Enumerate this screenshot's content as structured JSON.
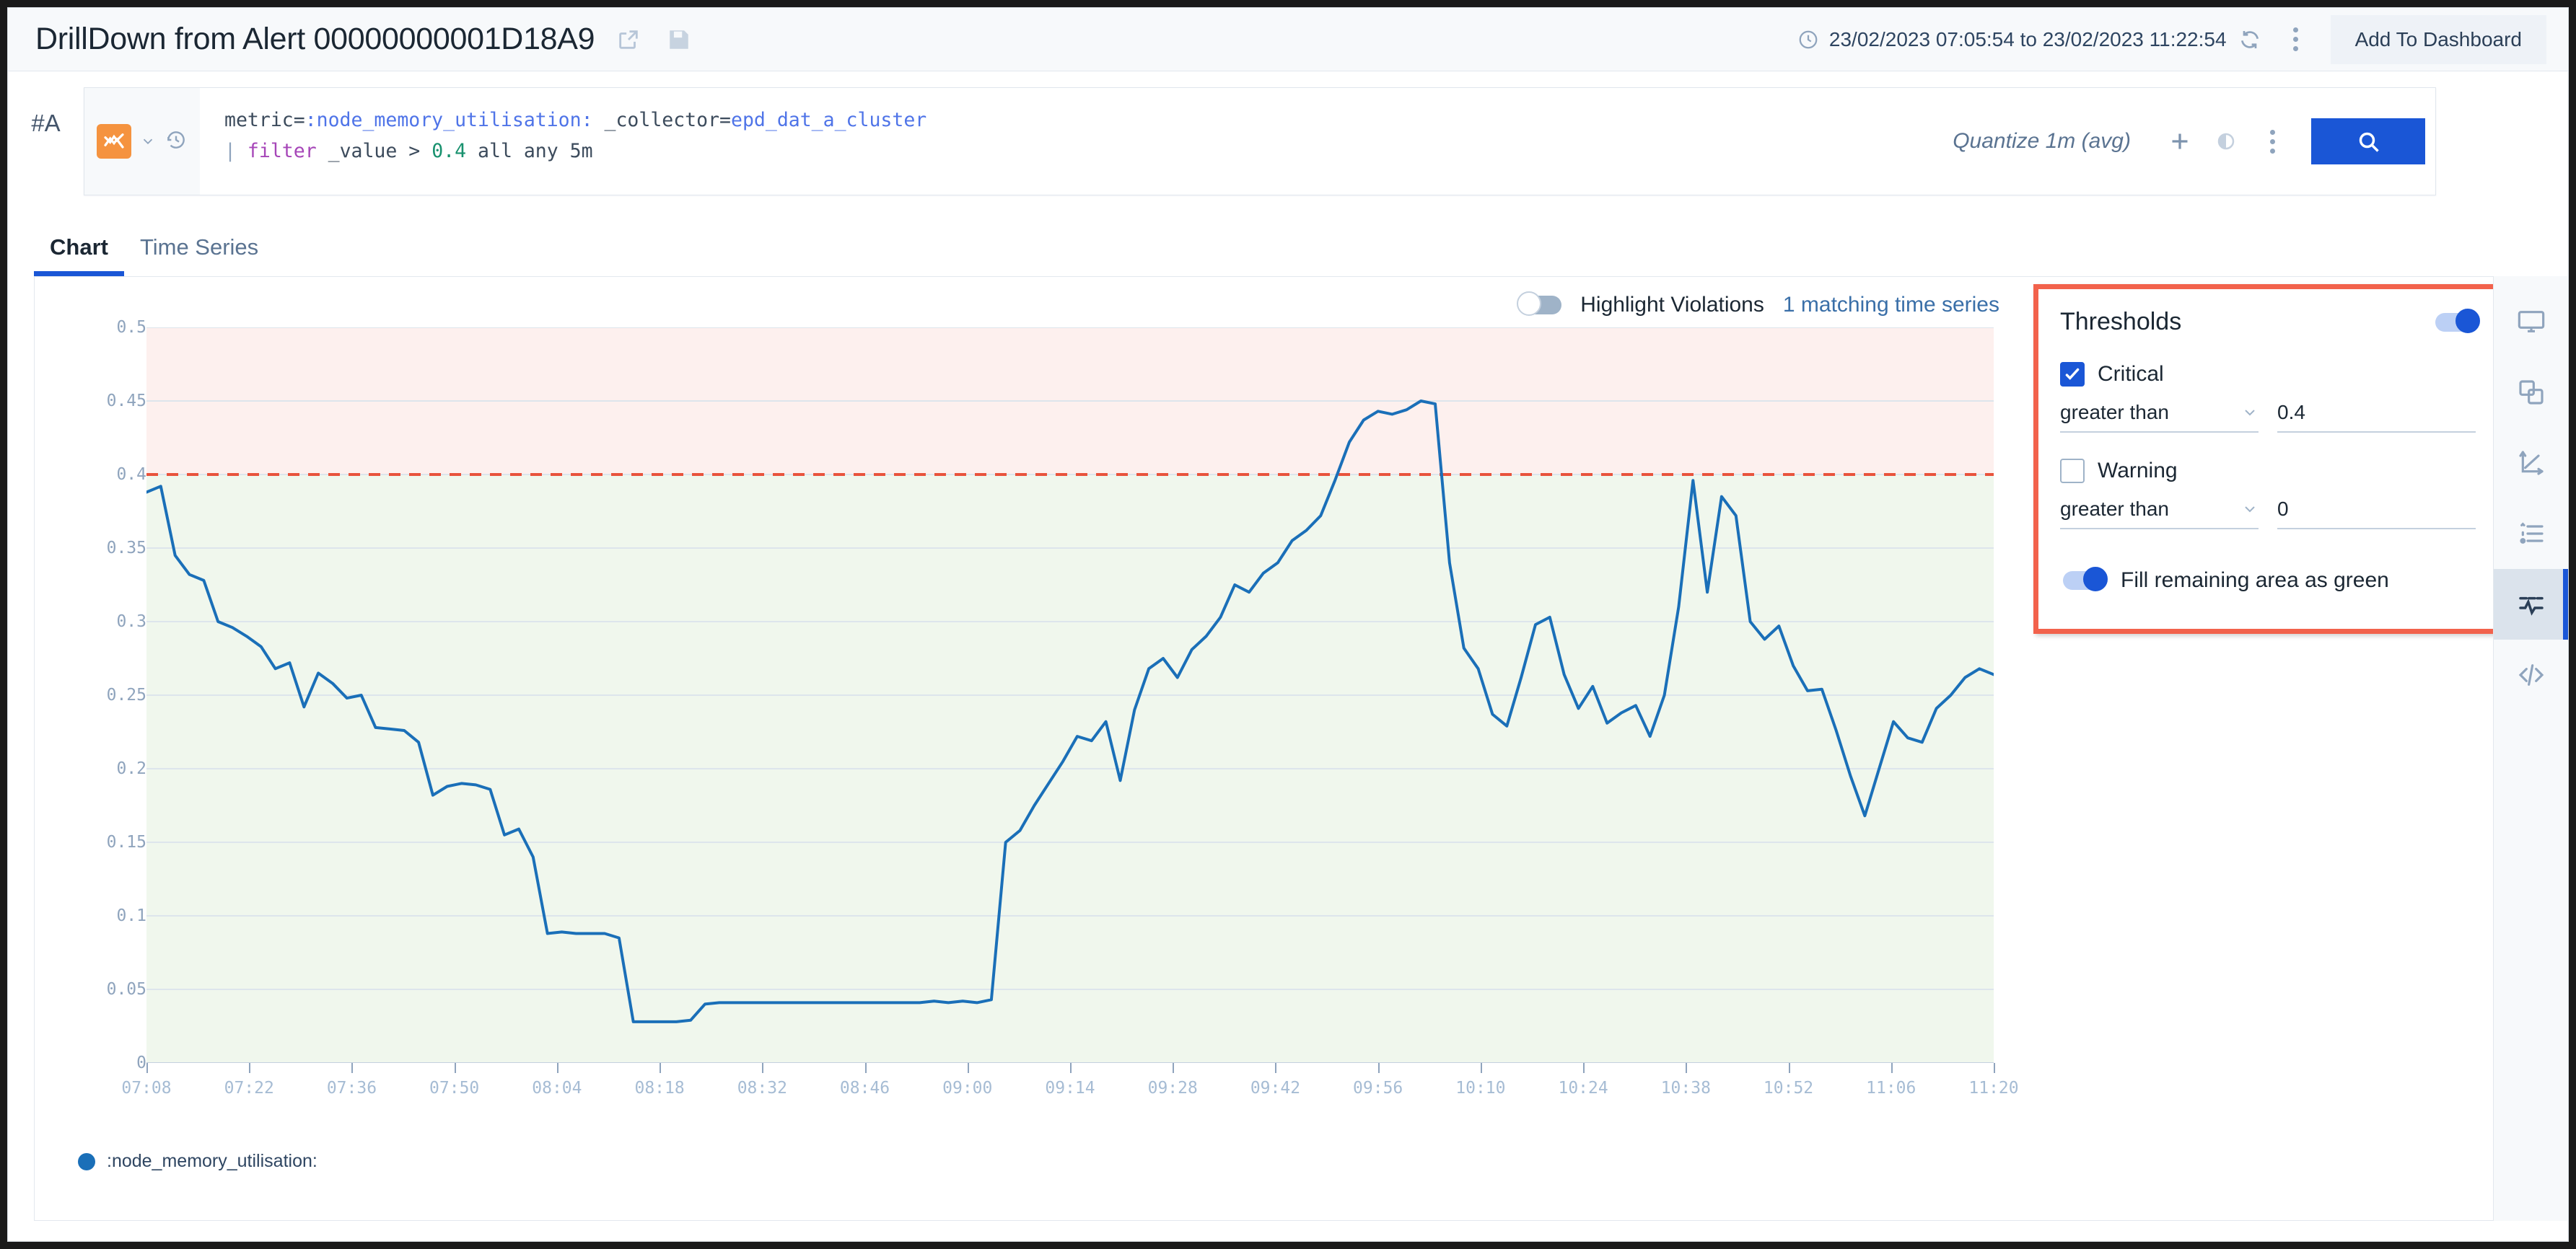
{
  "titlebar": {
    "title": "DrillDown from Alert 00000000001D18A9",
    "share_icon": "share-export-icon",
    "save_icon": "floppy-save-icon",
    "clock_icon": "clock-icon",
    "time_range": "23/02/2023 07:05:54 to 23/02/2023 11:22:54",
    "refresh_icon": "refresh-icon",
    "menu_icon": "kebab-menu-icon",
    "add_to_dashboard": "Add To Dashboard"
  },
  "query": {
    "id_label": "#A",
    "type_icon": "chart-type-icon",
    "chevron_icon": "chevron-down-icon",
    "history_icon": "history-clock-icon",
    "line1_prefix": "metric=",
    "line1_metric": ":node_memory_utilisation:",
    "line1_mid": " _collector=",
    "line1_collector": "epd_dat_a_cluster",
    "line2_pipe": "| ",
    "line2_kw": "filter",
    "line2_mid": " _value > ",
    "line2_num": "0.4",
    "line2_tail": " all any 5m",
    "quantize": "Quantize 1m (avg)",
    "add_icon": "plus-icon",
    "eye_icon": "eye-visibility-icon",
    "more_icon": "kebab-menu-icon",
    "search_icon": "search-icon"
  },
  "tabs": [
    {
      "label": "Chart",
      "active": true
    },
    {
      "label": "Time Series",
      "active": false
    }
  ],
  "chart_header": {
    "highlight_violations_label": "Highlight Violations",
    "highlight_violations_on": false,
    "matching_series": "1 matching time series"
  },
  "thresholds": {
    "title": "Thresholds",
    "enabled": true,
    "critical": {
      "label": "Critical",
      "checked": true,
      "operator": "greater than",
      "value": "0.4"
    },
    "warning": {
      "label": "Warning",
      "checked": false,
      "operator": "greater than",
      "value": "0"
    },
    "fill_label": "Fill remaining area as green",
    "fill_on": true,
    "accent_border": "#f2624c"
  },
  "rail": [
    {
      "icon": "monitor-display-icon",
      "active": false
    },
    {
      "icon": "layers-icon",
      "active": false
    },
    {
      "icon": "axes-icon",
      "active": false
    },
    {
      "icon": "list-icon",
      "active": false
    },
    {
      "icon": "thresholds-icon",
      "active": true
    },
    {
      "icon": "code-icon",
      "active": false
    }
  ],
  "legend": {
    "series_label": ":node_memory_utilisation:",
    "color": "#1a6fb8"
  },
  "chart_data": {
    "type": "line",
    "title": "",
    "xlabel": "",
    "ylabel": "metric=:node_memory_utilisation:",
    "ylim": [
      0,
      0.5
    ],
    "yticks": [
      0,
      0.05,
      0.1,
      0.15,
      0.2,
      0.25,
      0.3,
      0.35,
      0.4,
      0.45,
      0.5
    ],
    "xticks": [
      "07:08",
      "07:22",
      "07:36",
      "07:50",
      "08:04",
      "08:18",
      "08:32",
      "08:46",
      "09:00",
      "09:14",
      "09:28",
      "09:42",
      "09:56",
      "10:10",
      "10:24",
      "10:38",
      "10:52",
      "11:06",
      "11:20"
    ],
    "x_start": "07:05:54",
    "x_end": "11:22:54",
    "grid": true,
    "legend_position": "bottom-left",
    "line_color": "#1a6fb8",
    "bands": [
      {
        "name": "critical",
        "from": 0.4,
        "to": 0.5,
        "color": "#fdf0ee"
      },
      {
        "name": "ok",
        "from": 0,
        "to": 0.4,
        "color": "#f0f7ed"
      }
    ],
    "threshold_line": {
      "value": 0.4,
      "color": "#e8533c",
      "style": "dashed"
    },
    "series": [
      {
        "name": ":node_memory_utilisation:",
        "values": [
          0.388,
          0.392,
          0.345,
          0.332,
          0.328,
          0.3,
          0.296,
          0.29,
          0.283,
          0.268,
          0.272,
          0.242,
          0.265,
          0.258,
          0.248,
          0.25,
          0.228,
          0.227,
          0.226,
          0.218,
          0.182,
          0.188,
          0.19,
          0.189,
          0.186,
          0.155,
          0.159,
          0.14,
          0.088,
          0.089,
          0.088,
          0.088,
          0.088,
          0.085,
          0.028,
          0.028,
          0.028,
          0.028,
          0.029,
          0.04,
          0.041,
          0.041,
          0.041,
          0.041,
          0.041,
          0.041,
          0.041,
          0.041,
          0.041,
          0.041,
          0.041,
          0.041,
          0.041,
          0.041,
          0.041,
          0.042,
          0.041,
          0.042,
          0.041,
          0.043,
          0.15,
          0.158,
          0.175,
          0.19,
          0.205,
          0.222,
          0.219,
          0.232,
          0.192,
          0.24,
          0.268,
          0.275,
          0.262,
          0.281,
          0.29,
          0.303,
          0.325,
          0.32,
          0.333,
          0.34,
          0.355,
          0.362,
          0.372,
          0.396,
          0.422,
          0.437,
          0.443,
          0.441,
          0.444,
          0.45,
          0.448,
          0.34,
          0.282,
          0.268,
          0.237,
          0.229,
          0.262,
          0.298,
          0.303,
          0.264,
          0.241,
          0.256,
          0.231,
          0.238,
          0.243,
          0.222,
          0.25,
          0.31,
          0.396,
          0.32,
          0.385,
          0.372,
          0.3,
          0.288,
          0.297,
          0.27,
          0.253,
          0.254,
          0.226,
          0.195,
          0.168,
          0.2,
          0.232,
          0.221,
          0.218,
          0.241,
          0.25,
          0.262,
          0.268,
          0.264
        ]
      }
    ]
  }
}
